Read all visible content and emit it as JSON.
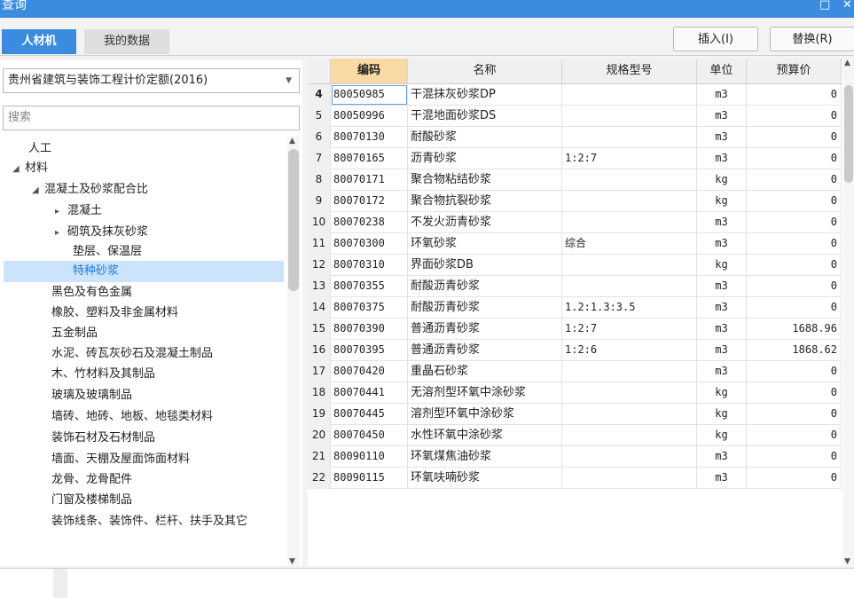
{
  "window": {
    "title": "查询",
    "restore_glyph": "□",
    "close_glyph": "✕"
  },
  "tabs": [
    {
      "label": "人材机"
    },
    {
      "label": "我的数据"
    }
  ],
  "toolbar": {
    "insert_label": "插入(I)",
    "replace_label": "替换(R)"
  },
  "left": {
    "quota_select": "贵州省建筑与装饰工程计价定额(2016)",
    "search_placeholder": "搜索",
    "tree": [
      {
        "label": "人工"
      },
      {
        "label": "材料"
      },
      {
        "label": "混凝土及砂浆配合比"
      },
      {
        "label": "混凝土"
      },
      {
        "label": "砌筑及抹灰砂浆"
      },
      {
        "label": "垫层、保温层"
      },
      {
        "label": "特种砂浆"
      },
      {
        "label": "黑色及有色金属"
      },
      {
        "label": "橡胶、塑料及非金属材料"
      },
      {
        "label": "五金制品"
      },
      {
        "label": "水泥、砖瓦灰砂石及混凝土制品"
      },
      {
        "label": "木、竹材料及其制品"
      },
      {
        "label": "玻璃及玻璃制品"
      },
      {
        "label": "墙砖、地砖、地板、地毯类材料"
      },
      {
        "label": "装饰石材及石材制品"
      },
      {
        "label": "墙面、天棚及屋面饰面材料"
      },
      {
        "label": "龙骨、龙骨配件"
      },
      {
        "label": "门窗及楼梯制品"
      },
      {
        "label": "装饰线条、装饰件、栏杆、扶手及其它"
      }
    ]
  },
  "table": {
    "columns": [
      "编码",
      "名称",
      "规格型号",
      "单位",
      "预算价"
    ],
    "rows": [
      {
        "no": "4",
        "code": "80050985",
        "name": "干混抹灰砂浆DP",
        "spec": "",
        "unit": "m3",
        "price": "0"
      },
      {
        "no": "5",
        "code": "80050996",
        "name": "干混地面砂浆DS",
        "spec": "",
        "unit": "m3",
        "price": "0"
      },
      {
        "no": "6",
        "code": "80070130",
        "name": "耐酸砂浆",
        "spec": "",
        "unit": "m3",
        "price": "0"
      },
      {
        "no": "7",
        "code": "80070165",
        "name": "沥青砂浆",
        "spec": "1:2:7",
        "unit": "m3",
        "price": "0"
      },
      {
        "no": "8",
        "code": "80070171",
        "name": "聚合物粘结砂浆",
        "spec": "",
        "unit": "kg",
        "price": "0"
      },
      {
        "no": "9",
        "code": "80070172",
        "name": "聚合物抗裂砂浆",
        "spec": "",
        "unit": "kg",
        "price": "0"
      },
      {
        "no": "10",
        "code": "80070238",
        "name": "不发火沥青砂浆",
        "spec": "",
        "unit": "m3",
        "price": "0"
      },
      {
        "no": "11",
        "code": "80070300",
        "name": "环氧砂浆",
        "spec": "综合",
        "unit": "m3",
        "price": "0"
      },
      {
        "no": "12",
        "code": "80070310",
        "name": "界面砂浆DB",
        "spec": "",
        "unit": "kg",
        "price": "0"
      },
      {
        "no": "13",
        "code": "80070355",
        "name": "耐酸沥青砂浆",
        "spec": "",
        "unit": "m3",
        "price": "0"
      },
      {
        "no": "14",
        "code": "80070375",
        "name": "耐酸沥青砂浆",
        "spec": "1.2:1.3:3.5",
        "unit": "m3",
        "price": "0"
      },
      {
        "no": "15",
        "code": "80070390",
        "name": "普通沥青砂浆",
        "spec": "1:2:7",
        "unit": "m3",
        "price": "1688.96"
      },
      {
        "no": "16",
        "code": "80070395",
        "name": "普通沥青砂浆",
        "spec": "1:2:6",
        "unit": "m3",
        "price": "1868.62"
      },
      {
        "no": "17",
        "code": "80070420",
        "name": "重晶石砂浆",
        "spec": "",
        "unit": "m3",
        "price": "0"
      },
      {
        "no": "18",
        "code": "80070441",
        "name": "无溶剂型环氧中涂砂浆",
        "spec": "",
        "unit": "kg",
        "price": "0"
      },
      {
        "no": "19",
        "code": "80070445",
        "name": "溶剂型环氧中涂砂浆",
        "spec": "",
        "unit": "kg",
        "price": "0"
      },
      {
        "no": "20",
        "code": "80070450",
        "name": "水性环氧中涂砂浆",
        "spec": "",
        "unit": "kg",
        "price": "0"
      },
      {
        "no": "21",
        "code": "80090110",
        "name": "环氧煤焦油砂浆",
        "spec": "",
        "unit": "m3",
        "price": "0"
      },
      {
        "no": "22",
        "code": "80090115",
        "name": "环氧呋喃砂浆",
        "spec": "",
        "unit": "m3",
        "price": "0"
      }
    ]
  }
}
